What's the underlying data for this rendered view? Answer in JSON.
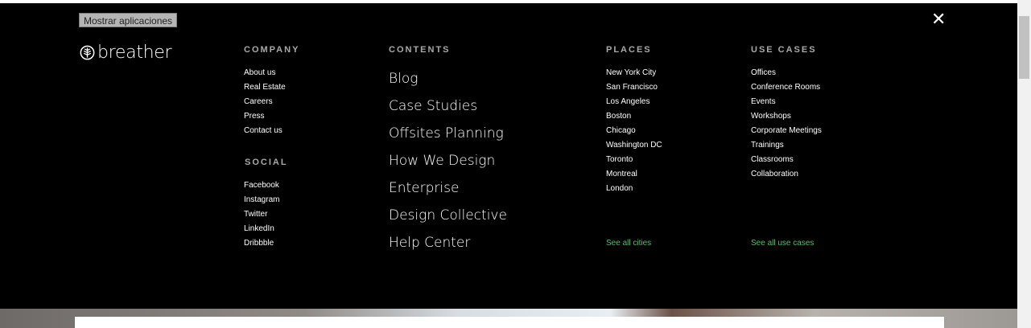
{
  "apps_button": "Mostrar aplicaciones",
  "close_symbol": "✕",
  "logo_text": "breather",
  "company": {
    "heading": "COMPANY",
    "items": [
      "About us",
      "Real Estate",
      "Careers",
      "Press",
      "Contact us"
    ]
  },
  "social": {
    "heading": "SOCIAL",
    "items": [
      "Facebook",
      "Instagram",
      "Twitter",
      "LinkedIn",
      "Dribbble"
    ]
  },
  "contents": {
    "heading": "CONTENTS",
    "items": [
      "Blog",
      "Case Studies",
      "Offsites Planning",
      "How We Design",
      "Enterprise",
      "Design Collective",
      "Help Center"
    ]
  },
  "places": {
    "heading": "PLACES",
    "items": [
      "New York City",
      "San Francisco",
      "Los Angeles",
      "Boston",
      "Chicago",
      "Washington DC",
      "Toronto",
      "Montreal",
      "London"
    ],
    "see_all": "See all cities"
  },
  "use_cases": {
    "heading": "USE CASES",
    "items": [
      "Offices",
      "Conference Rooms",
      "Events",
      "Workshops",
      "Corporate Meetings",
      "Trainings",
      "Classrooms",
      "Collaboration"
    ],
    "see_all": "See all use cases"
  },
  "colors": {
    "background": "#000000",
    "accent_green": "#5cb971",
    "heading_gray": "#a8a8a8"
  }
}
